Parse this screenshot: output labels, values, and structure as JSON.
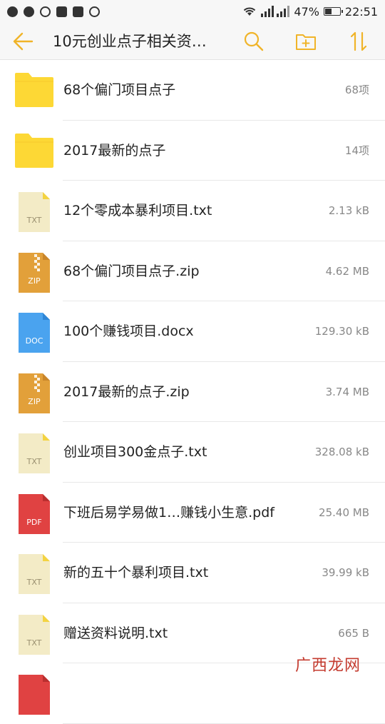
{
  "status_bar": {
    "signal_label": "ııl ııl",
    "battery_percent": "47%",
    "time": "22:51",
    "battery_level": 0.47
  },
  "toolbar": {
    "title": "10元创业点子相关资…"
  },
  "files": [
    {
      "name": "68个偏门项目点子",
      "meta": "68项",
      "type": "folder"
    },
    {
      "name": "2017最新的点子",
      "meta": "14项",
      "type": "folder"
    },
    {
      "name": "12个零成本暴利项目.txt",
      "meta": "2.13 kB",
      "type": "txt",
      "badge": "TXT"
    },
    {
      "name": "68个偏门项目点子.zip",
      "meta": "4.62 MB",
      "type": "zip",
      "badge": "ZIP"
    },
    {
      "name": "100个赚钱项目.docx",
      "meta": "129.30 kB",
      "type": "doc",
      "badge": "DOC"
    },
    {
      "name": "2017最新的点子.zip",
      "meta": "3.74 MB",
      "type": "zip",
      "badge": "ZIP"
    },
    {
      "name": "创业项目300金点子.txt",
      "meta": "328.08 kB",
      "type": "txt",
      "badge": "TXT"
    },
    {
      "name": "下班后易学易做1…赚钱小生意.pdf",
      "meta": "25.40 MB",
      "type": "pdf",
      "badge": "PDF"
    },
    {
      "name": "新的五十个暴利项目.txt",
      "meta": "39.99 kB",
      "type": "txt",
      "badge": "TXT"
    },
    {
      "name": "赠送资料说明.txt",
      "meta": "665 B",
      "type": "txt",
      "badge": "TXT"
    },
    {
      "name": "",
      "meta": "",
      "type": "pdf",
      "badge": ""
    }
  ],
  "colors": {
    "accent": "#f0b429",
    "folder": "#fdd835",
    "txt": "#f3ebc6",
    "txt_corner": "#f3d341",
    "zip": "#e2a03a",
    "doc": "#4aa3ef",
    "pdf": "#e04242"
  },
  "watermark": "广西龙网"
}
